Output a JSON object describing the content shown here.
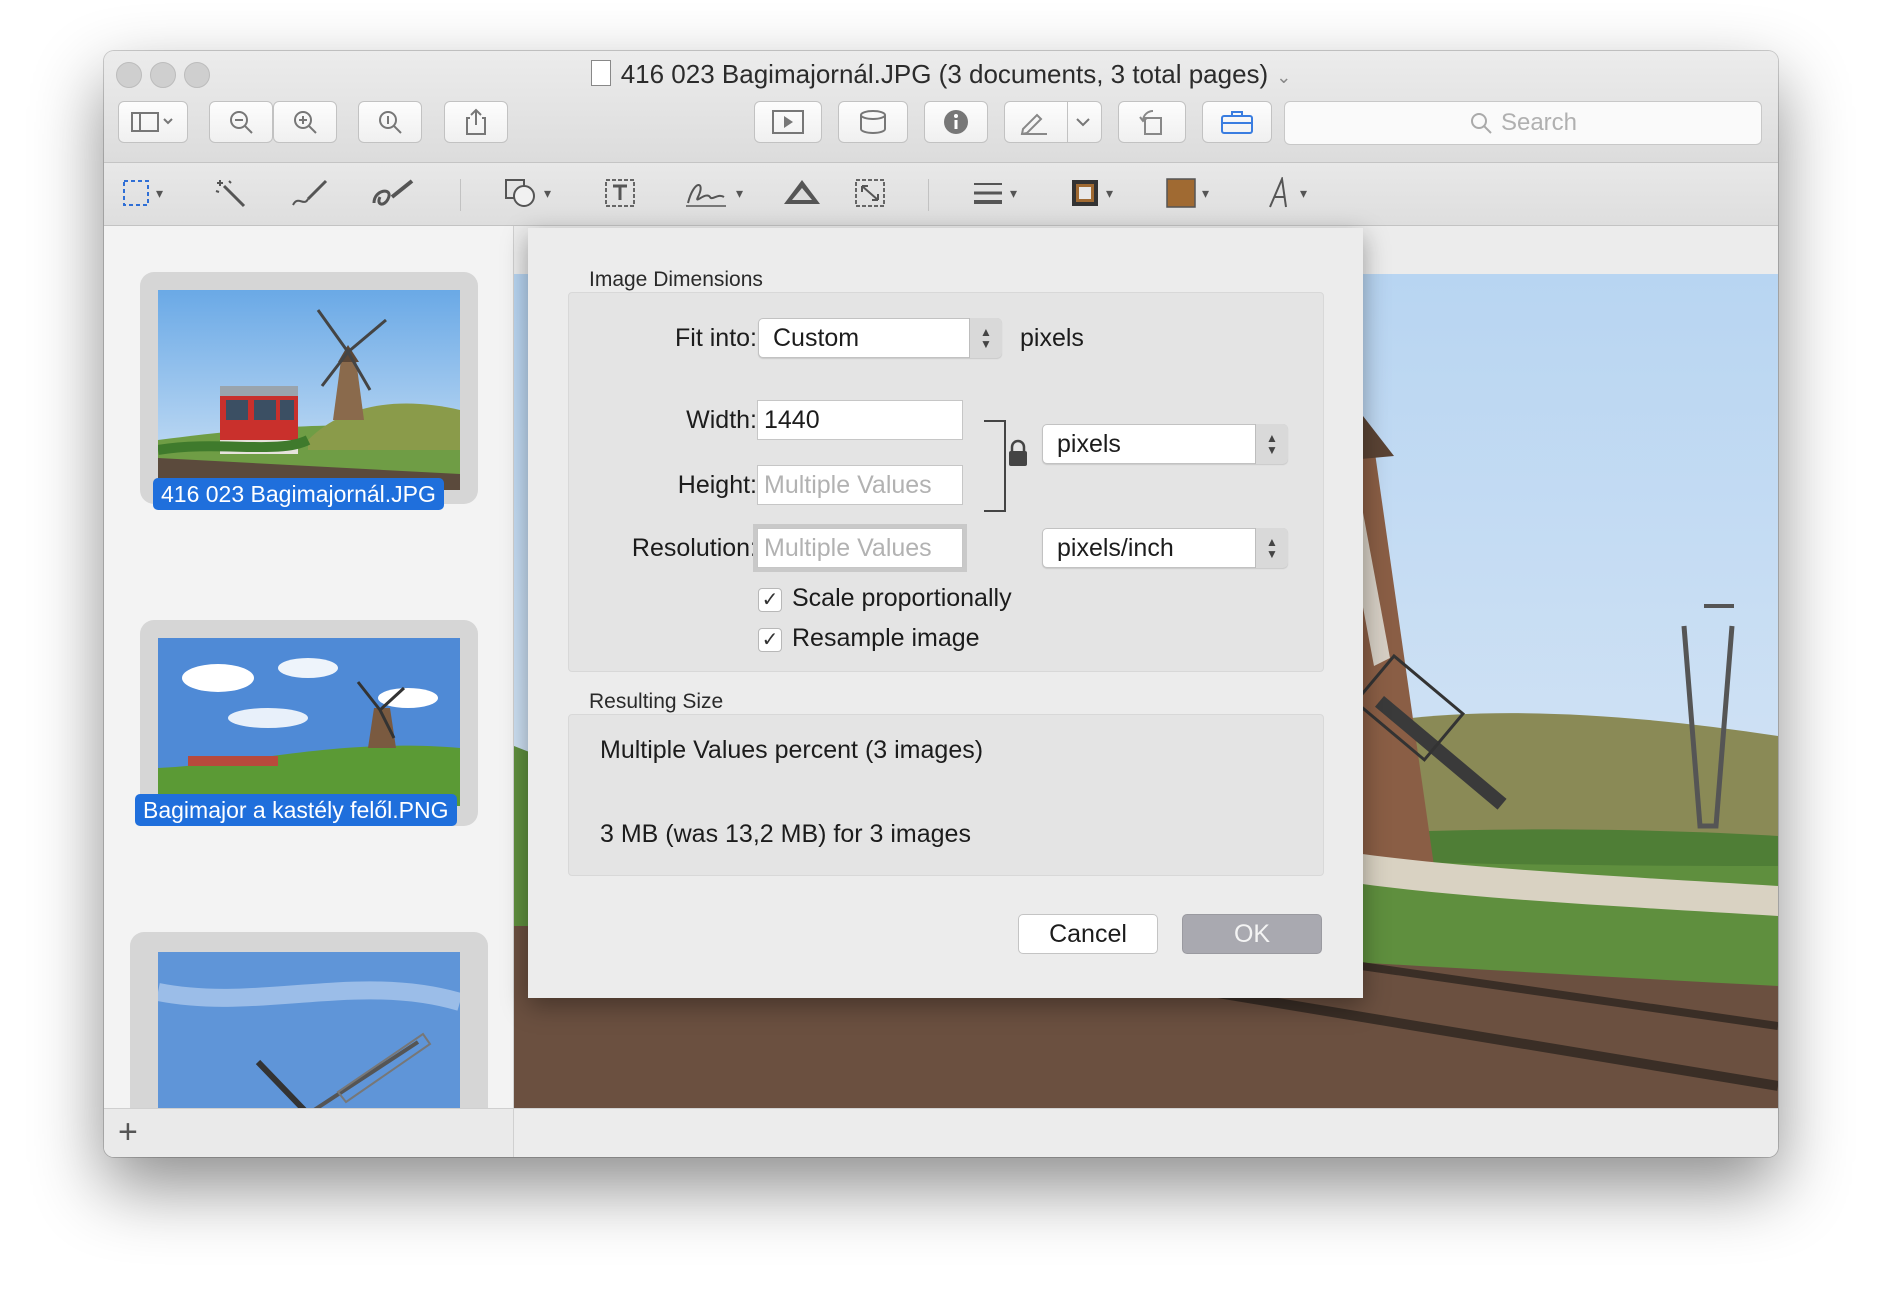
{
  "window": {
    "title": "416 023 Bagimajornál.JPG (3 documents, 3 total pages)"
  },
  "toolbar": {
    "search_placeholder": "Search"
  },
  "sidebar": {
    "items": [
      {
        "label": "416 023 Bagimajornál.JPG",
        "selected": true
      },
      {
        "label": "Bagimajor a kastély felől.PNG",
        "selected": true
      },
      {
        "label": "",
        "selected": false
      }
    ],
    "add_label": "+"
  },
  "dialog": {
    "image_dimensions_title": "Image Dimensions",
    "fit_into_label": "Fit into:",
    "fit_into_value": "Custom",
    "fit_into_units": "pixels",
    "width_label": "Width:",
    "width_value": "1440",
    "height_label": "Height:",
    "height_placeholder": "Multiple Values",
    "resolution_label": "Resolution:",
    "resolution_placeholder": "Multiple Values",
    "size_units_value": "pixels",
    "resolution_units_value": "pixels/inch",
    "scale_label": "Scale proportionally",
    "scale_checked": true,
    "resample_label": "Resample image",
    "resample_checked": true,
    "resulting_size_title": "Resulting Size",
    "result_percent": "Multiple Values percent (3 images)",
    "result_size": "3 MB (was 13,2 MB) for 3 images",
    "cancel_label": "Cancel",
    "ok_label": "OK"
  },
  "colors": {
    "selection_blue": "#1f6fdc",
    "ok_disabled": "#a9a9b0",
    "fill_color_swatch": "#a06a32"
  }
}
